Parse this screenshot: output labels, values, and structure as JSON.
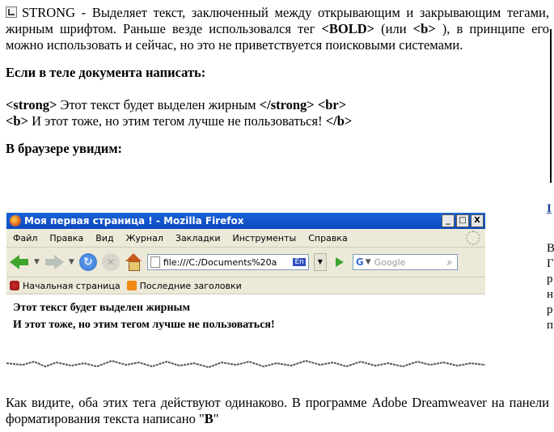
{
  "article": {
    "p1_text": "STRONG - Выделяет текст, заключенный между открывающим и закрывающим тегами, жирным шрифтом. Раньше везде использовался тег ",
    "p1_bold1": "<BOLD>",
    "p1_mid": " (или ",
    "p1_bold2": "<b>",
    "p1_end": " ), в принципе его можно использовать и сейчас, но это не приветствуется поисковыми системами.",
    "heading1": "Если в теле документа написать:",
    "code1_a": "<strong>",
    "code1_b": " Этот текст будет выделен жирным ",
    "code1_c": "</strong>",
    "code1_d": " ",
    "code1_e": "<br>",
    "code2_a": "<b>",
    "code2_b": " И этот тоже, но этим тегом лучше не пользоваться! ",
    "code2_c": "</b>",
    "heading2": "В браузере увидим:",
    "after_text": "Как видите, оба этих тега действуют одинаково. В программе Adobe Dreamweaver на панели форматирования текста написано \"",
    "after_bold": "B",
    "after_end": "\""
  },
  "right_fragments": {
    "link": "I",
    "lines": [
      "В",
      "Г",
      "р",
      "н",
      "р",
      "п"
    ]
  },
  "browser": {
    "title": "Моя первая страница ! - Mozilla Firefox",
    "win_buttons": [
      "_",
      "□",
      "X"
    ],
    "menu": [
      "Файл",
      "Правка",
      "Вид",
      "Журнал",
      "Закладки",
      "Инструменты",
      "Справка"
    ],
    "url": "file:///C:/Documents%20a",
    "url_lang": "En",
    "search_placeholder": "Google",
    "search_engine": "G",
    "bookmarks": [
      "Начальная страница",
      "Последние заголовки"
    ],
    "content_line1": "Этот текст будет выделен жирным",
    "content_line2": "И этот тоже, но этим тегом лучше не пользоваться!"
  },
  "icons": [
    "paragraph-icon",
    "firefox-icon",
    "back-arrow-icon",
    "forward-arrow-icon",
    "reload-icon",
    "stop-icon",
    "home-icon",
    "page-icon",
    "go-icon",
    "search-icon",
    "bookmark-home-icon",
    "rss-icon"
  ]
}
